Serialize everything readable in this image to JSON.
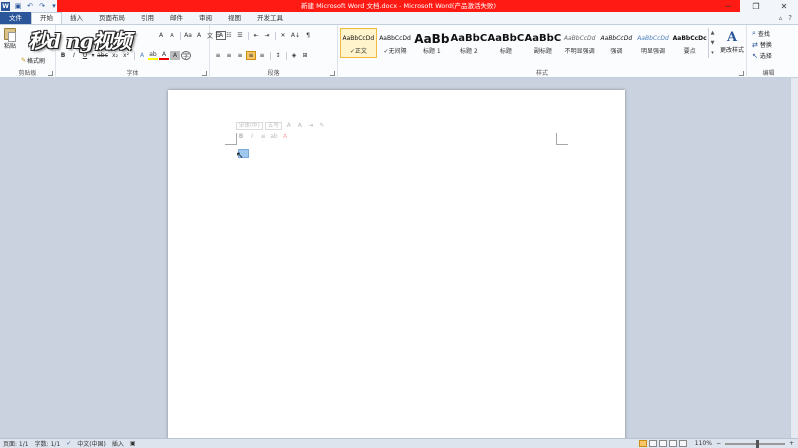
{
  "window": {
    "title": "新建 Microsoft Word 文档.docx - Microsoft Word(产品激活失败)",
    "minimize_glyph": "─",
    "maximize_glyph": "❐",
    "close_glyph": "✕",
    "brand_color": "#2b579a",
    "titlebar_color": "#ff1b14"
  },
  "qat": {
    "word_icon": "W",
    "save_glyph": "▣",
    "undo_glyph": "↶",
    "redo_glyph": "↷",
    "customize_glyph": "▾"
  },
  "tabs": [
    {
      "label": "文件"
    },
    {
      "label": "开始"
    },
    {
      "label": "插入"
    },
    {
      "label": "页面布局"
    },
    {
      "label": "引用"
    },
    {
      "label": "邮件"
    },
    {
      "label": "审阅"
    },
    {
      "label": "视图"
    },
    {
      "label": "开发工具"
    }
  ],
  "tab_right": {
    "minimize_ribbon": "▵",
    "help": "?"
  },
  "ribbon": {
    "clipboard": {
      "paste": "粘贴",
      "format_painter": "格式刷",
      "label": "剪贴板"
    },
    "font": {
      "label": "字体",
      "grow": "A",
      "shrink": "A",
      "aa": "Aa",
      "clear": "A",
      "pinyin": "文",
      "border": "A",
      "bold": "B",
      "italic": "I",
      "underline": "U",
      "strike": "abc",
      "sub": "x₂",
      "sup": "x²",
      "effects": "A",
      "highlight": "ab",
      "color": "A",
      "shade": "A",
      "enclose": "字"
    },
    "paragraph": {
      "label": "段落",
      "bullets": "☰",
      "numbering": "☷",
      "multilevel": "☰",
      "dec_indent": "⇤",
      "inc_indent": "⇥",
      "chinese_layout": "✕",
      "sort": "A↓",
      "show_marks": "¶",
      "align_left": "≡",
      "align_center": "≡",
      "align_right": "≡",
      "justify": "≡",
      "distribute": "≡",
      "line_spacing": "↕",
      "shading": "◈",
      "borders": "⊞"
    },
    "styles": {
      "label": "样式",
      "items": [
        {
          "sample": "AaBbCcDd",
          "name": "正文"
        },
        {
          "sample": "AaBbCcDd",
          "name": "无间隔"
        },
        {
          "sample": "AaBb",
          "name": "标题 1"
        },
        {
          "sample": "AaBbC",
          "name": "标题 2"
        },
        {
          "sample": "AaBbC",
          "name": "标题"
        },
        {
          "sample": "AaBbC",
          "name": "副标题"
        },
        {
          "sample": "AaBbCcDd",
          "name": "不明显强调"
        },
        {
          "sample": "AaBbCcDd",
          "name": "强调"
        },
        {
          "sample": "AaBbCcDd",
          "name": "明显强调"
        },
        {
          "sample": "AaBbCcDc",
          "name": "要点"
        }
      ],
      "scroll_up": "▲",
      "scroll_down": "▼",
      "more": "▾",
      "change_styles_icon": "A",
      "change_styles": "更改样式"
    },
    "editing": {
      "label": "编辑",
      "find": "查找",
      "replace": "替换",
      "select": "选择"
    }
  },
  "logo": {
    "text": "秒d ng视频"
  },
  "mini_toolbar": {
    "font": "宋体",
    "font_dd": "(中)",
    "size": "五号",
    "bold": "B",
    "italic": "I",
    "align": "≡",
    "highlight": "ab",
    "color": "A",
    "indent": "⇥",
    "painter": "✎"
  },
  "status": {
    "page": "页面: 1/1",
    "words": "字数: 1/1",
    "proofing_icon": "✓",
    "language": "中文(中国)",
    "mode": "插入",
    "zoom": "110%",
    "zoom_out": "−",
    "zoom_in": "+",
    "zoom_level": 0.55
  }
}
